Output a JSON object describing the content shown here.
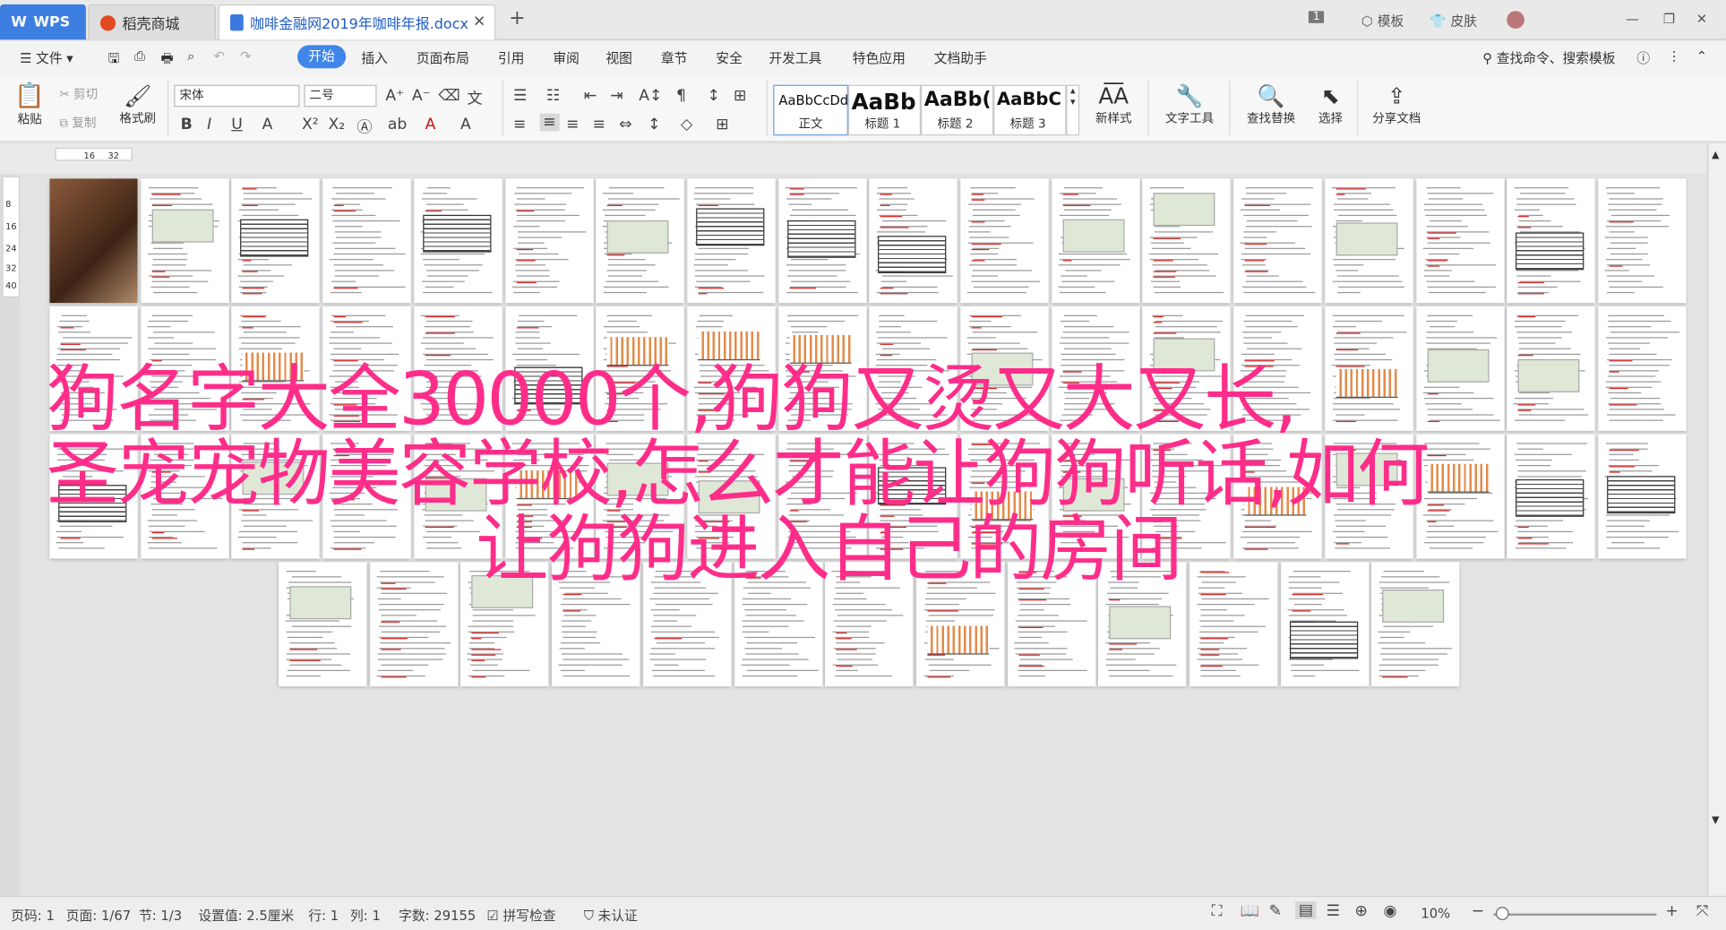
{
  "tabs": {
    "wps": "WPS",
    "store": "稻壳商城",
    "doc": "咖啡金融网2019年咖啡年报.docx"
  },
  "titlebar": {
    "page_badge": "1",
    "template": "模板",
    "skin": "皮肤"
  },
  "menu": [
    "文件",
    "开始",
    "插入",
    "页面布局",
    "引用",
    "审阅",
    "视图",
    "章节",
    "安全",
    "开发工具",
    "特色应用",
    "文档助手"
  ],
  "search": {
    "placeholder": "查找命令、搜索模板"
  },
  "toolbar": {
    "paste": "粘贴",
    "cut": "剪切",
    "copy": "复制",
    "format_painter": "格式刷",
    "font": "宋体",
    "size": "二号",
    "styles": [
      {
        "sample": "AaBbCcDd",
        "label": "正文"
      },
      {
        "sample": "AaBb",
        "label": "标题 1"
      },
      {
        "sample": "AaBb(",
        "label": "标题 2"
      },
      {
        "sample": "AaBbC",
        "label": "标题 3"
      }
    ],
    "new_style": "新样式",
    "text_tools": "文字工具",
    "find_replace": "查找替换",
    "select": "选择",
    "share": "分享文档"
  },
  "ruler": {
    "h": [
      "16",
      "32"
    ],
    "v": [
      "8",
      "16",
      "24",
      "32",
      "40"
    ]
  },
  "overlay": {
    "line1": "狗名字大全30000个,狗狗又烫又大又长,",
    "line2": "圣宠宠物美容学校,怎么才能让狗狗听话,如何",
    "line3": "让狗狗进入自己的房间"
  },
  "status": {
    "page_num": "页码: 1",
    "page": "页面: 1/67",
    "section": "节: 1/3",
    "setting": "设置值: 2.5厘米",
    "row": "行: 1",
    "col": "列: 1",
    "words": "字数: 29155",
    "spell": "拼写检查",
    "cert": "未认证",
    "zoom": "10%"
  },
  "colors": {
    "accent": "#3f86e8",
    "overlay_text": "#ff2d8a"
  }
}
